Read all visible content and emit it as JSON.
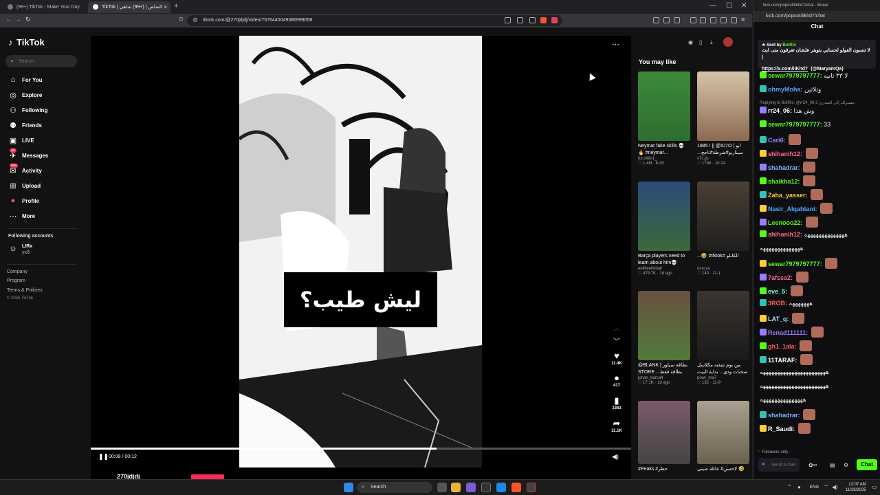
{
  "browser": {
    "tabs": [
      {
        "label": "(99+) TikTok - Make Your Day"
      },
      {
        "label": "TikTok | ‎شاص | (+99) شاهي#"
      }
    ],
    "url": "tiktok.com/@270jdjdj/video/7576440049386999058"
  },
  "tiktok": {
    "logo": "TikTok",
    "search_placeholder": "Search",
    "nav": [
      {
        "label": "For You",
        "icon": "home-icon"
      },
      {
        "label": "Explore",
        "icon": "compass-icon"
      },
      {
        "label": "Following",
        "icon": "person-icon"
      },
      {
        "label": "Friends",
        "icon": "friends-icon"
      },
      {
        "label": "LIVE",
        "icon": "live-icon"
      },
      {
        "label": "Messages",
        "icon": "messages-icon",
        "badge": "20"
      },
      {
        "label": "Activity",
        "icon": "activity-icon",
        "badge": "99+"
      },
      {
        "label": "Upload",
        "icon": "upload-icon"
      },
      {
        "label": "Profile",
        "icon": "profile-icon"
      },
      {
        "label": "More",
        "icon": "more-icon"
      }
    ],
    "following_heading": "Following accounts",
    "following_account": {
      "name": "LIRx",
      "handle": "yx8"
    },
    "footer": [
      "Company",
      "Program",
      "Terms & Policies",
      "© 2025 TikTok"
    ],
    "video": {
      "caption": "ليش طيب؟",
      "time": "00:08 / 00:12",
      "progress": 0.64,
      "likes": "11.4K",
      "comments": "417",
      "saves": "1363",
      "shares": "11.1K",
      "username": "270jdjdj"
    },
    "recommended_heading": "You may like",
    "cards": [
      {
        "title": "Neymar fake skills 💀🔥 #neymar...",
        "author": "fut.vittin1_",
        "meta": "♡ 1.4M · 8-30",
        "color": "#3b8a3a"
      },
      {
        "title": "1985 ! || @ID7O | ‎ابو ‎...سيناريو#شرطة#ناجح",
        "author": "v7c.jjs",
        "meta": "♡ 1746 · 10-24",
        "color": "#b9a48a"
      },
      {
        "title": "Barça players need to learn about him💀",
        "author": "eelliteefxtball",
        "meta": "♡ 479.7K · 1d ago",
        "color": "#2c4a7a"
      },
      {
        "title": "...🤣 #tiktok# ‎الكابلو",
        "author": "osxcza",
        "meta": "♡ 140 · 11-1",
        "color": "#4a4035"
      },
      {
        "title": "@BLANK | ‎بطاقة سيلور ‎STORE ‎...بطاقة فقط برشلونة",
        "author": "johan_barca4",
        "meta": "♡ 17.1K · 1d ago",
        "color": "#4f7a3a"
      },
      {
        "title": "‎من يوم شفته مكلاسل بداية البيت ‎...صحبات ودي 💀🤣",
        "author": "powr_ma7",
        "meta": "♡ 132 · 11-9",
        "color": "#3a3530"
      },
      {
        "title": "#‎Peaks ‎#حظر",
        "author": "",
        "meta": "",
        "color": "#7a5a6a"
      },
      {
        "title": "‎عائلة صيني ‎#لاحسن 🤣😹",
        "author": "",
        "meta": "",
        "color": "#8a8070"
      }
    ]
  },
  "chat": {
    "window_title": "kick.com/popout/iikhd7/chat - Brave",
    "url": "kick.com/popout/iikhd7/chat",
    "heading": "Chat",
    "pinned": {
      "sent_by_label": "Sent by",
      "bot": "BotRix",
      "message": "لا تنسون الفولو لحسابي بتويتر علشان تعرفون متى ايث |",
      "link": "https://x.com/iiKhd7",
      "handle": "(@MaryamQa)"
    },
    "messages": [
      {
        "user": "sewar7979797777:",
        "text": "لا ٣٣ ثانيه",
        "color": "#53fc18"
      },
      {
        "user": "ohmyMoha:",
        "text": "وثلاثين",
        "color": "#4aa8ff"
      },
      {
        "reply": "Replying to BotRix: @rr24_06 3 ‎مسترلك إلى الصدري"
      },
      {
        "user": "rr24_06:",
        "text": "وش هذا",
        "color": "#ffffff"
      },
      {
        "user": "sewar7979797777:",
        "text": "33",
        "color": "#53fc18"
      },
      {
        "user": "Cari6:",
        "text": "",
        "color": "#9b7bff"
      },
      {
        "user": "shihanih12:",
        "text": "",
        "color": "#ff6a8a"
      },
      {
        "user": "shahadrar:",
        "text": "",
        "color": "#7ab3ff"
      },
      {
        "user": "shaikha12:",
        "text": "",
        "color": "#53fc18"
      },
      {
        "user": "Zaha_yasser:",
        "text": "",
        "color": "#ffcc33"
      },
      {
        "user": "Nasir_Alqahtani:",
        "text": "",
        "color": "#4aa8ff"
      },
      {
        "user": "Leenooo22:",
        "text": "",
        "color": "#53fc18"
      },
      {
        "user": "shihanih12:",
        "text": "ههههههههههههههه",
        "color": "#ff6a8a"
      },
      {
        "user": "",
        "text": "ههههههههههههههه",
        "color": "#ffffff"
      },
      {
        "user": "sewar7979797777:",
        "text": "",
        "color": "#53fc18"
      },
      {
        "user": "7afssa2:",
        "text": "",
        "color": "#ff6a8a"
      },
      {
        "user": "eve_5:",
        "text": "",
        "color": "#7affcc"
      },
      {
        "user": "3ROB:",
        "text": "هههههههه",
        "color": "#ff5a5a"
      },
      {
        "user": "LAT_q:",
        "text": "",
        "color": "#9be6ff"
      },
      {
        "user": "Renad111111:",
        "text": "",
        "color": "#9b7bff"
      },
      {
        "user": "gh1_1ala:",
        "text": "",
        "color": "#ff5a5a"
      },
      {
        "user": "11TARAF:",
        "text": "",
        "color": "#ffffff"
      },
      {
        "user": "",
        "text": "هههههههههههههههههههههههه",
        "color": "#ffffff"
      },
      {
        "user": "",
        "text": "هههههههههههههههههههههههه",
        "color": "#ffffff"
      },
      {
        "user": "",
        "text": "هههههههههههههههه",
        "color": "#ffffff"
      },
      {
        "user": "shahadrar:",
        "text": "",
        "color": "#7ab3ff"
      },
      {
        "user": "R_Saudi:",
        "text": "",
        "color": "#ffffff"
      }
    ],
    "followers_only": "♡ Followers only",
    "send_placeholder": "Send a message",
    "chat_button": "Chat",
    "accent": "#53fc18"
  },
  "taskbar": {
    "search": "Search",
    "lang": "ENG",
    "time": "12:07 AM",
    "date": "11/28/2025"
  }
}
